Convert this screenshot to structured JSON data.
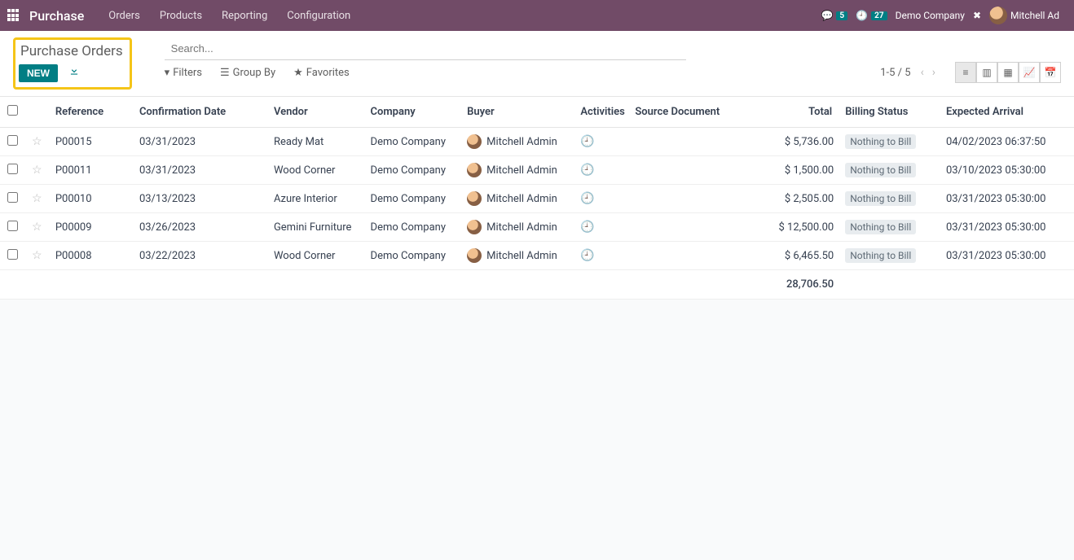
{
  "topnav": {
    "brand": "Purchase",
    "items": [
      "Orders",
      "Products",
      "Reporting",
      "Configuration"
    ],
    "msg_count": "5",
    "clock_count": "27",
    "company": "Demo Company",
    "user": "Mitchell Ad"
  },
  "header": {
    "title": "Purchase Orders",
    "new_label": "NEW"
  },
  "search": {
    "placeholder": "Search...",
    "filters": "Filters",
    "groupby": "Group By",
    "favorites": "Favorites"
  },
  "pager": {
    "text": "1-5 / 5"
  },
  "columns": {
    "reference": "Reference",
    "confirmation": "Confirmation Date",
    "vendor": "Vendor",
    "company": "Company",
    "buyer": "Buyer",
    "activities": "Activities",
    "source": "Source Document",
    "total": "Total",
    "billing": "Billing Status",
    "arrival": "Expected Arrival"
  },
  "rows": [
    {
      "ref": "P00015",
      "conf": "03/31/2023",
      "vendor": "Ready Mat",
      "company": "Demo Company",
      "buyer": "Mitchell Admin",
      "total": "$ 5,736.00",
      "billing": "Nothing to Bill",
      "arrival": "04/02/2023 06:37:50"
    },
    {
      "ref": "P00011",
      "conf": "03/31/2023",
      "vendor": "Wood Corner",
      "company": "Demo Company",
      "buyer": "Mitchell Admin",
      "total": "$ 1,500.00",
      "billing": "Nothing to Bill",
      "arrival": "03/10/2023 05:30:00"
    },
    {
      "ref": "P00010",
      "conf": "03/13/2023",
      "vendor": "Azure Interior",
      "company": "Demo Company",
      "buyer": "Mitchell Admin",
      "total": "$ 2,505.00",
      "billing": "Nothing to Bill",
      "arrival": "03/31/2023 05:30:00"
    },
    {
      "ref": "P00009",
      "conf": "03/26/2023",
      "vendor": "Gemini Furniture",
      "company": "Demo Company",
      "buyer": "Mitchell Admin",
      "total": "$ 12,500.00",
      "billing": "Nothing to Bill",
      "arrival": "03/31/2023 05:30:00"
    },
    {
      "ref": "P00008",
      "conf": "03/22/2023",
      "vendor": "Wood Corner",
      "company": "Demo Company",
      "buyer": "Mitchell Admin",
      "total": "$ 6,465.50",
      "billing": "Nothing to Bill",
      "arrival": "03/31/2023 05:30:00"
    }
  ],
  "grand_total": "28,706.50"
}
